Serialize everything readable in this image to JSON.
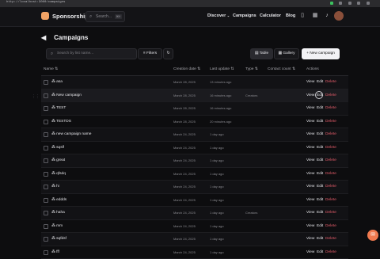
{
  "browser": {
    "url": "http://localhost:3000/campaigns"
  },
  "nav": {
    "brand": "Sponsorship",
    "search_placeholder": "Search...",
    "search_kbd": "⌘K",
    "links": [
      "Discover",
      "Campaigns",
      "Calculator",
      "Blog"
    ],
    "discover_chevron": "⌄"
  },
  "page": {
    "title": "Campaigns",
    "filter_placeholder": "Search by list name...",
    "filters_label": "Filters",
    "table_label": "Table",
    "gallery_label": "Gallery",
    "new_campaign_label": "+ New campaign"
  },
  "table": {
    "headers": [
      "Name",
      "Creation date",
      "Last update",
      "Type",
      "Contact count",
      "Actions"
    ],
    "actions": {
      "view": "View",
      "edit": "Edit",
      "delete": "Delete"
    },
    "rows": [
      {
        "name": "asa",
        "created": "March 28, 2025",
        "updated": "13 minutes ago",
        "type": ""
      },
      {
        "name": "New campaign",
        "created": "March 28, 2025",
        "updated": "16 minutes ago",
        "type": "Creators"
      },
      {
        "name": "TEST",
        "created": "March 28, 2025",
        "updated": "16 minutes ago",
        "type": ""
      },
      {
        "name": "TESTDS",
        "created": "March 28, 2025",
        "updated": "20 minutes ago",
        "type": ""
      },
      {
        "name": "new campaign name",
        "created": "March 24, 2025",
        "updated": "1 day ago",
        "type": ""
      },
      {
        "name": "sqslf",
        "created": "March 24, 2025",
        "updated": "1 day ago",
        "type": ""
      },
      {
        "name": "great",
        "created": "March 24, 2025",
        "updated": "1 day ago",
        "type": ""
      },
      {
        "name": "qfsdq",
        "created": "March 24, 2025",
        "updated": "1 day ago",
        "type": ""
      },
      {
        "name": "hi",
        "created": "March 24, 2025",
        "updated": "1 day ago",
        "type": ""
      },
      {
        "name": "eddds",
        "created": "March 24, 2025",
        "updated": "1 day ago",
        "type": ""
      },
      {
        "name": "haha",
        "created": "March 24, 2025",
        "updated": "1 day ago",
        "type": "Creators"
      },
      {
        "name": "mm",
        "created": "March 24, 2025",
        "updated": "1 day ago",
        "type": ""
      },
      {
        "name": "sqfdsf",
        "created": "March 24, 2025",
        "updated": "1 day ago",
        "type": ""
      },
      {
        "name": "fff",
        "created": "March 24, 2025",
        "updated": "1 day ago",
        "type": ""
      }
    ]
  },
  "colors": {
    "accent": "#f2a365",
    "delete": "#e65c6a",
    "fab": "#f07a4f"
  }
}
